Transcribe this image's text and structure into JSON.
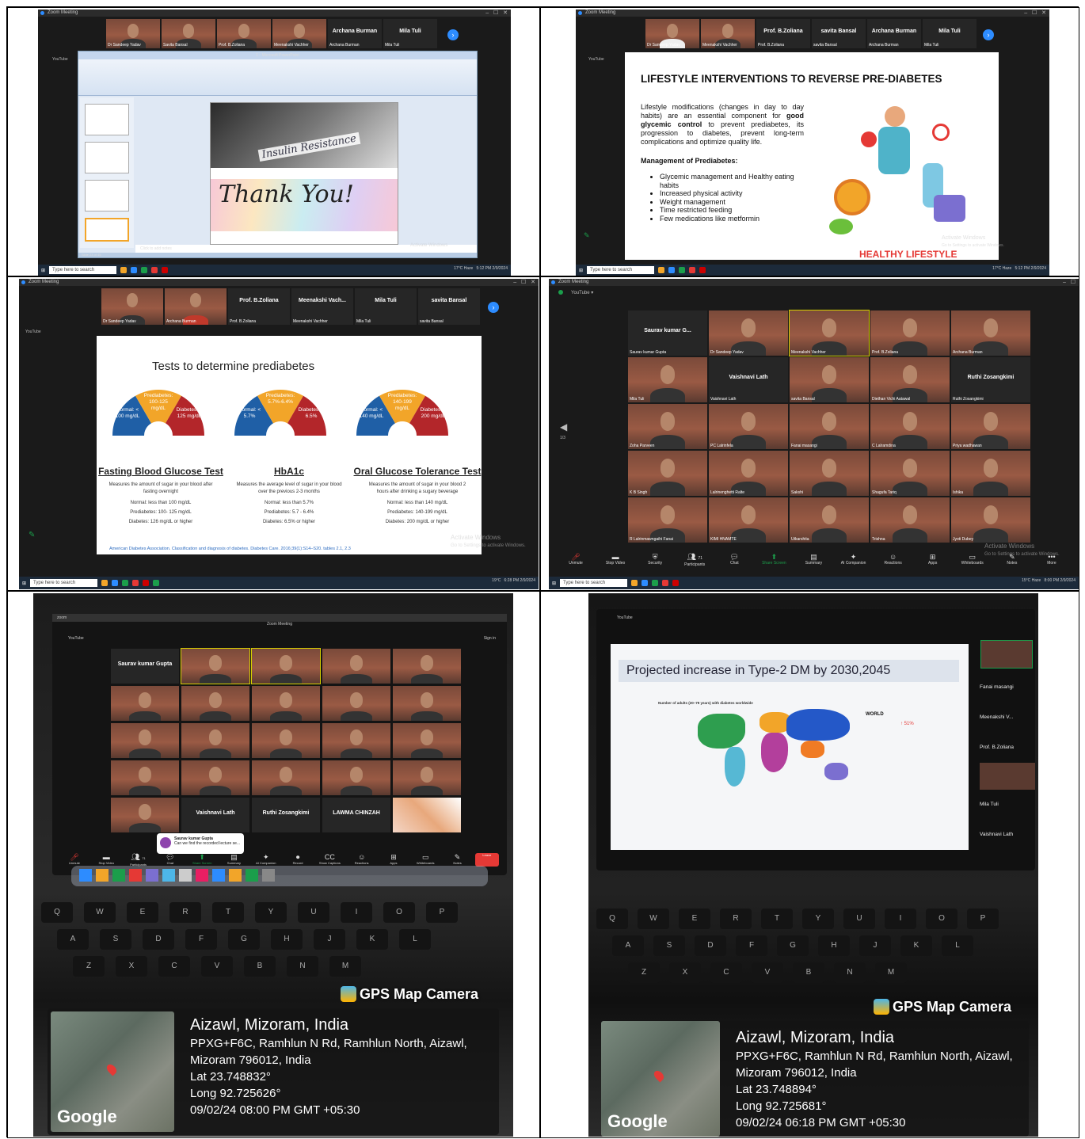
{
  "panel1": {
    "title": "Zoom Meeting",
    "participants": [
      "Dr Sandeep Yadav",
      "Savita Bansal",
      "Prof. B.Zoliana",
      "Meenakshi Vachher",
      "Archana Burman",
      "Mila Tuli"
    ],
    "big_names": [
      "Archana Burman",
      "Mila Tuli"
    ],
    "ppt_title": "1 - Microsoft PowerPoint",
    "slide_text_1": "Insulin Resistance",
    "slide_text_2": "Thank You!",
    "notes": "Click to add notes",
    "status": "Slide 23 of 45",
    "youtube": "YouTube",
    "taskbar_search": "Type here to search",
    "weather": "17°C Haze",
    "time": "5:12 PM",
    "date": "2/9/2024"
  },
  "panel2": {
    "title": "Zoom Meeting",
    "participants": [
      "Dr Sandeep Yadav",
      "Meenakshi Vachher",
      "Prof. B.Zoliana",
      "savita Bansal",
      "Archana Burman",
      "Mila Tuli"
    ],
    "big_names": [
      "Prof. B.Zoliana",
      "savita Bansal",
      "Archana Burman",
      "Mila Tuli"
    ],
    "youtube": "YouTube",
    "slide_title": "LIFESTYLE INTERVENTIONS TO REVERSE PRE-DIABETES",
    "intro_pre": "Lifestyle modifications (changes in day to day habits) are an essential component for",
    "intro_bold": "good glycemic control",
    "intro_post": "to prevent prediabetes, its progression to diabetes, prevent long-term complications and optimize quality life.",
    "mgmt_heading": "Management of Prediabetes",
    "bullets": [
      "Glycemic management and Healthy eating habits",
      "Increased physical activity",
      "Weight management",
      "Time restricted feeding",
      "Few medications like metformin"
    ],
    "image_caption": "HEALTHY LIFESTYLE",
    "watermark": "Activate Windows",
    "watermark_sub": "Go to Settings to activate Windows.",
    "taskbar_search": "Type here to search",
    "weather": "17°C Haze",
    "time": "5:12 PM",
    "date": "2/9/2024"
  },
  "panel3": {
    "title": "Zoom Meeting",
    "participants": [
      "Dr Sandeep Yadav",
      "Archana Burman",
      "Prof. B.Zoliana",
      "Meenakshi Vachher",
      "Mila Tuli",
      "savita Bansal"
    ],
    "big_names": [
      "Prof. B.Zoliana",
      "Meenakshi Vach...",
      "Mila Tuli",
      "savita Bansal"
    ],
    "youtube": "YouTube",
    "slide_title": "Tests to determine prediabetes",
    "tests": [
      {
        "name": "Fasting Blood Glucose Test",
        "normal": "Normal: < 100 mg/dL",
        "pre": "Prediabetes: 100-125 mg/dL",
        "dia": "Diabetes: ≥ 125 mg/dL",
        "desc": "Measures the amount of sugar in your blood after fasting overnight",
        "s1": "Normal: less than 100 mg/dL",
        "s2": "Prediabetes: 100- 125 mg/dL",
        "s3": "Diabetes: 126 mg/dL or higher"
      },
      {
        "name": "HbA1c",
        "normal": "Normal: < 5.7%",
        "pre": "Prediabetes: 5.7%-6.4%",
        "dia": "Diabetes: ≥ 6.5%",
        "desc": "Measures the average level of sugar in your blood over the previous 2-3 months",
        "s1": "Normal: less than 5.7%",
        "s2": "Prediabetes: 5.7 - 6.4%",
        "s3": "Diabetes: 6.5% or higher"
      },
      {
        "name": "Oral Glucose Tolerance Test",
        "normal": "Normal: < 140 mg/dL",
        "pre": "Prediabetes: 140-199 mg/dL",
        "dia": "Diabetes: ≥ 200 mg/dL",
        "desc": "Measures the amount of sugar in your blood 2 hours after drinking a sugary beverage",
        "s1": "Normal: less than 140 mg/dL",
        "s2": "Prediabetes: 140-199 mg/dL",
        "s3": "Diabetes: 200 mg/dL or higher"
      }
    ],
    "citation": "American Diabetes Association. Classification and diagnosis of diabetes. Diabetes Care. 2016;39(1):S14–S20. tables 2.1, 2.3",
    "watermark": "Activate Windows",
    "watermark_sub": "Go to Settings to activate Windows.",
    "taskbar_search": "Type here to search",
    "weather": "19°C",
    "time": "6:28 PM",
    "date": "2/9/2024"
  },
  "panel4": {
    "title": "Zoom Meeting",
    "youtube": "YouTube",
    "page": "1/3",
    "tiles": [
      "Saurav kumar Gupta",
      "Dr Sandeep Yadav",
      "Meenakshi Vachher",
      "Prof. B.Zoliana",
      "Archana Burman",
      "Mila Tuli",
      "Vaishnavi Lath",
      "savita Bansal",
      "Diethan Vichi Aatawal",
      "Ruthi Zosangkimi",
      "Zoha Parveen",
      "PC Lalrinfela",
      "Fanai masangi",
      "C Lalramdina",
      "Priya wadhawan",
      "K B Singh",
      "Lalrinenghetti Ralte",
      "Sakshi",
      "Shagufa Tariq",
      "Ishika",
      "R Lalrinmawngaihi Fanai",
      "KIMI HNAMTE",
      "Utkarshita",
      "Trishna",
      "Jyoti Dubey"
    ],
    "big_tiles": [
      "Saurav kumar G...",
      "Vaishnavi Lath",
      "Ruthi Zosangkimi"
    ],
    "toolbar": [
      "Unmute",
      "Stop Video",
      "Security",
      "Participants",
      "Chat",
      "Share Screen",
      "Summary",
      "AI Companion",
      "Reactions",
      "Apps",
      "Whiteboards",
      "Notes",
      "More"
    ],
    "participant_count": "71",
    "watermark": "Activate Windows",
    "watermark_sub": "Go to Settings to activate Windows.",
    "taskbar_search": "Type here to search",
    "weather": "15°C Haze",
    "time": "8:00 PM",
    "date": "2/9/2024"
  },
  "panel5": {
    "app": "zoom",
    "window": "Zoom Meeting",
    "youtube": "YouTube",
    "sign_in": "Sign in",
    "names": [
      "Saurav kumar Gupta",
      "Vaishnavi Lath",
      "Ruthi Zosangkimi",
      "LAWMA CHINZAH"
    ],
    "chat_name": "Saurav kumar Gupta",
    "chat_msg": "Can we find the recorded lecture se...",
    "participant_count": "71",
    "toolbar": [
      "Unmute",
      "Stop Video",
      "Participants",
      "Chat",
      "Share Screen",
      "Summary",
      "AI Companion",
      "Record",
      "Show Captions",
      "Reactions",
      "Apps",
      "Whiteboards",
      "Notes",
      "Leave"
    ],
    "brand": "GPS Map Camera",
    "location": "Aizawl, Mizoram, India",
    "address1": "PPXG+F6C, Ramhlun N Rd, Ramhlun North, Aizawl,",
    "address2": "Mizoram 796012, India",
    "lat": "Lat 23.748832°",
    "long": "Long 92.725626°",
    "datetime": "09/02/24 08:00 PM GMT +05:30",
    "map_brand": "Google"
  },
  "panel6": {
    "youtube": "YouTube",
    "slide_title": "Projected increase in Type-2 DM by 2030,2045",
    "map_heading": "Number of adults (20–79 years) with diabetes worldwide",
    "world_label": "WORLD",
    "world_pct": "51%",
    "side_names": [
      "Fanai masangi",
      "Meenakshi V...",
      "Prof. B.Zoliana",
      "Mila Tuli",
      "Vaishnavi Lath"
    ],
    "brand": "GPS Map Camera",
    "location": "Aizawl, Mizoram, India",
    "address1": "PPXG+F6C, Ramhlun N Rd, Ramhlun North, Aizawl,",
    "address2": "Mizoram 796012, India",
    "lat": "Lat 23.748894°",
    "long": "Long 92.725681°",
    "datetime": "09/02/24 06:18 PM GMT +05:30",
    "map_brand": "Google"
  },
  "colors": {
    "zoom_blue": "#2d8cff",
    "normal_blue": "#1f5fa6",
    "pre_orange": "#f2a529",
    "dia_red": "#b3262a",
    "title_red": "#e53935"
  }
}
